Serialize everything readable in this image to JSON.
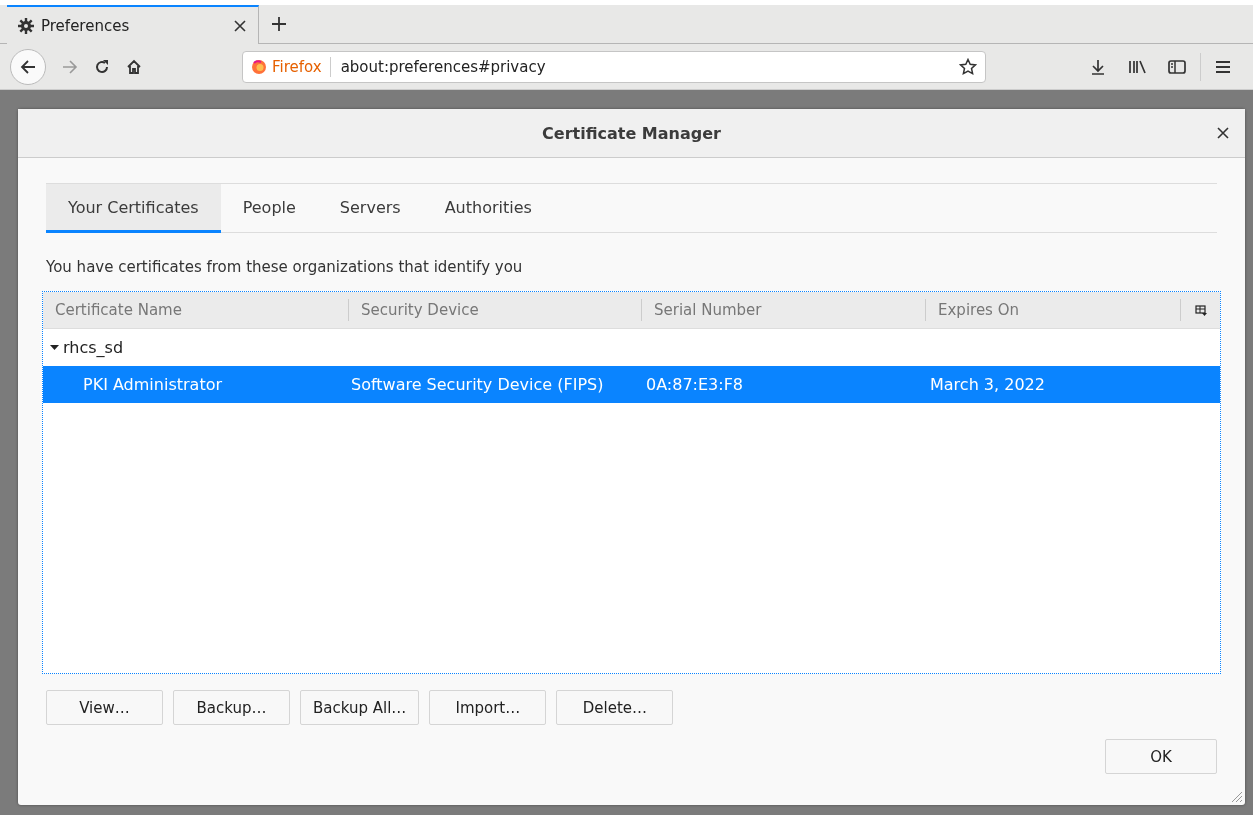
{
  "browser": {
    "tabs": [
      {
        "title": "Preferences",
        "selected": true
      }
    ],
    "toolbar": {
      "url_identity": "Firefox",
      "url": "about:preferences#privacy"
    }
  },
  "dialog": {
    "title": "Certificate Manager",
    "tabs": [
      {
        "label": "Your Certificates",
        "selected": true
      },
      {
        "label": "People",
        "selected": false
      },
      {
        "label": "Servers",
        "selected": false
      },
      {
        "label": "Authorities",
        "selected": false
      }
    ],
    "description": "You have certificates from these organizations that identify you",
    "table": {
      "columns": [
        "Certificate Name",
        "Security Device",
        "Serial Number",
        "Expires On"
      ],
      "rows": [
        {
          "label": "rhcs_sd",
          "expanded": true,
          "children": [
            {
              "cells": [
                "PKI Administrator",
                "Software Security Device (FIPS)",
                "0A:87:E3:F8",
                "March 3, 2022"
              ],
              "selected": true
            }
          ]
        }
      ]
    },
    "buttons": [
      "View…",
      "Backup…",
      "Backup All…",
      "Import…",
      "Delete…"
    ],
    "ok_button": "OK"
  }
}
